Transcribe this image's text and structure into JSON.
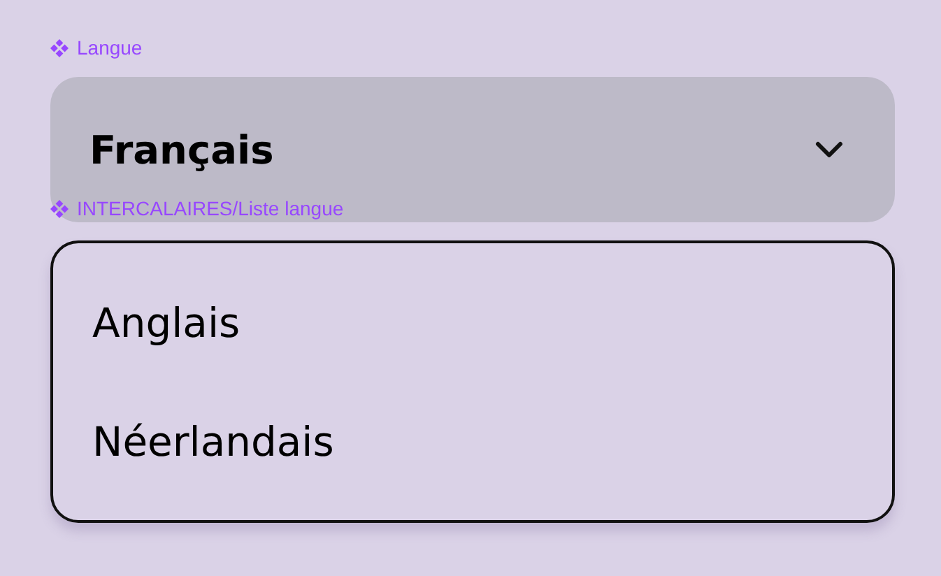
{
  "component_label": "Langue",
  "select": {
    "value": "Français",
    "expanded": true
  },
  "list_label": "INTERCALAIRES/Liste langue",
  "options": [
    {
      "label": "Anglais"
    },
    {
      "label": "Néerlandais"
    }
  ]
}
